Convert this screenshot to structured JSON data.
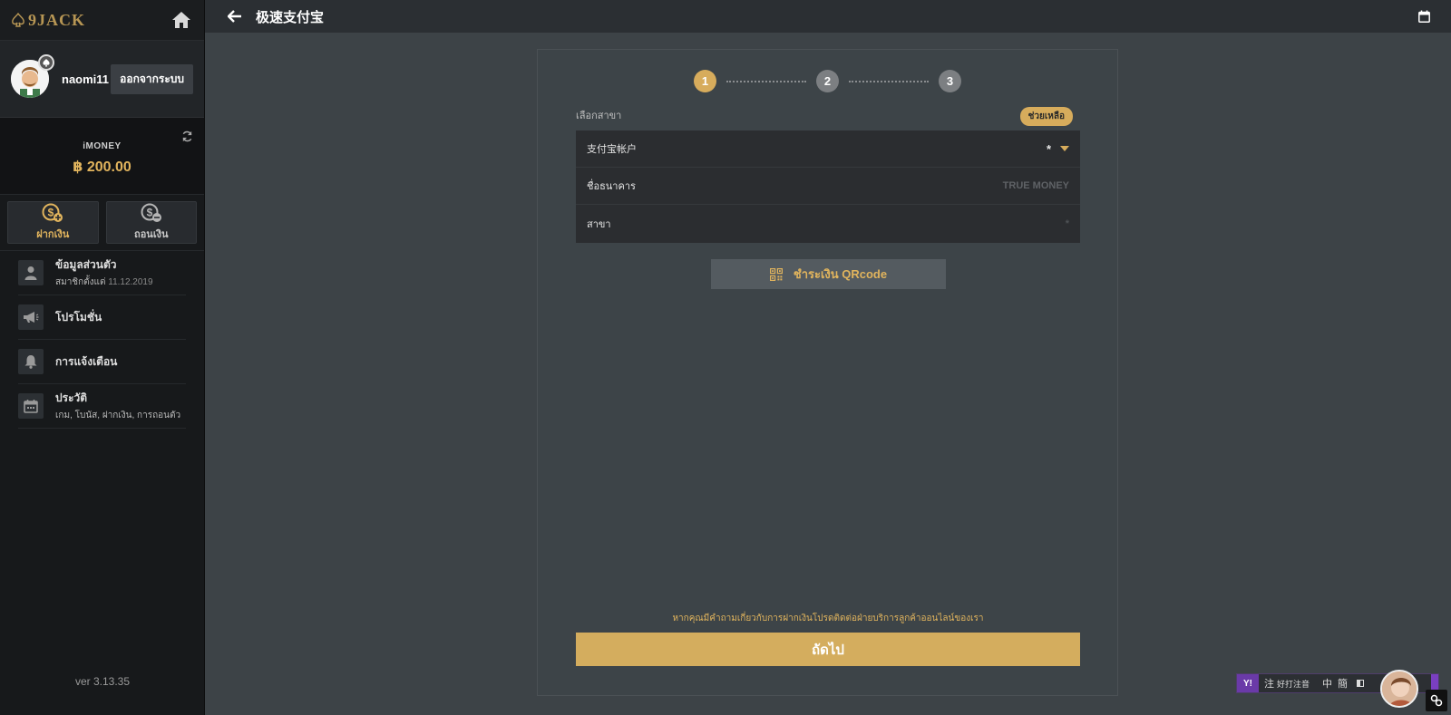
{
  "brand": {
    "logo_text": "9JACK"
  },
  "user": {
    "username": "naomi11",
    "logout_label": "ออกจากระบบ"
  },
  "wallet": {
    "label": "iMONEY",
    "amount": "฿ 200.00"
  },
  "actions": {
    "deposit_label": "ฝากเงิน",
    "withdraw_label": "ถอนเงิน"
  },
  "menu": {
    "profile": {
      "title": "ข้อมูลส่วนตัว",
      "sub_prefix": "สมาชิกตั้งแต่",
      "sub_date": "11.12.2019"
    },
    "promotions": {
      "title": "โปรโมชั่น"
    },
    "notifications": {
      "title": "การแจ้งเตือน"
    },
    "history": {
      "title": "ประวัติ",
      "sub": "เกม, โบนัส, ฝากเงิน, การถอนตัว"
    }
  },
  "version": "ver 3.13.35",
  "topbar": {
    "title": "极速支付宝"
  },
  "stepper": {
    "steps": [
      "1",
      "2",
      "3"
    ],
    "active": 1
  },
  "form": {
    "section_label": "เลือกสาขา",
    "help_label": "ช่วยเหลือ",
    "rows": {
      "account": {
        "label": "支付宝帐户",
        "required_mark": "*"
      },
      "bank": {
        "label": "ชื่อธนาคาร",
        "value": "TRUE MONEY"
      },
      "branch": {
        "label": "สาขา",
        "value": "*"
      }
    },
    "qr_label": "ชำระเงิน QRcode"
  },
  "notice": "หากคุณมีคำถามเกี่ยวกับการฝากเงินโปรดติดต่อฝ่ายบริการลูกค้าออนไลน์ของเรา",
  "next_label": "ถัดไป",
  "ime": {
    "logo": "Y!",
    "c1": "注",
    "c2": "好打注音",
    "c3": "中",
    "c4": "簡"
  },
  "colors": {
    "accent": "#d7ac5c",
    "sidebar": "#17191b",
    "background": "#3d4347"
  }
}
